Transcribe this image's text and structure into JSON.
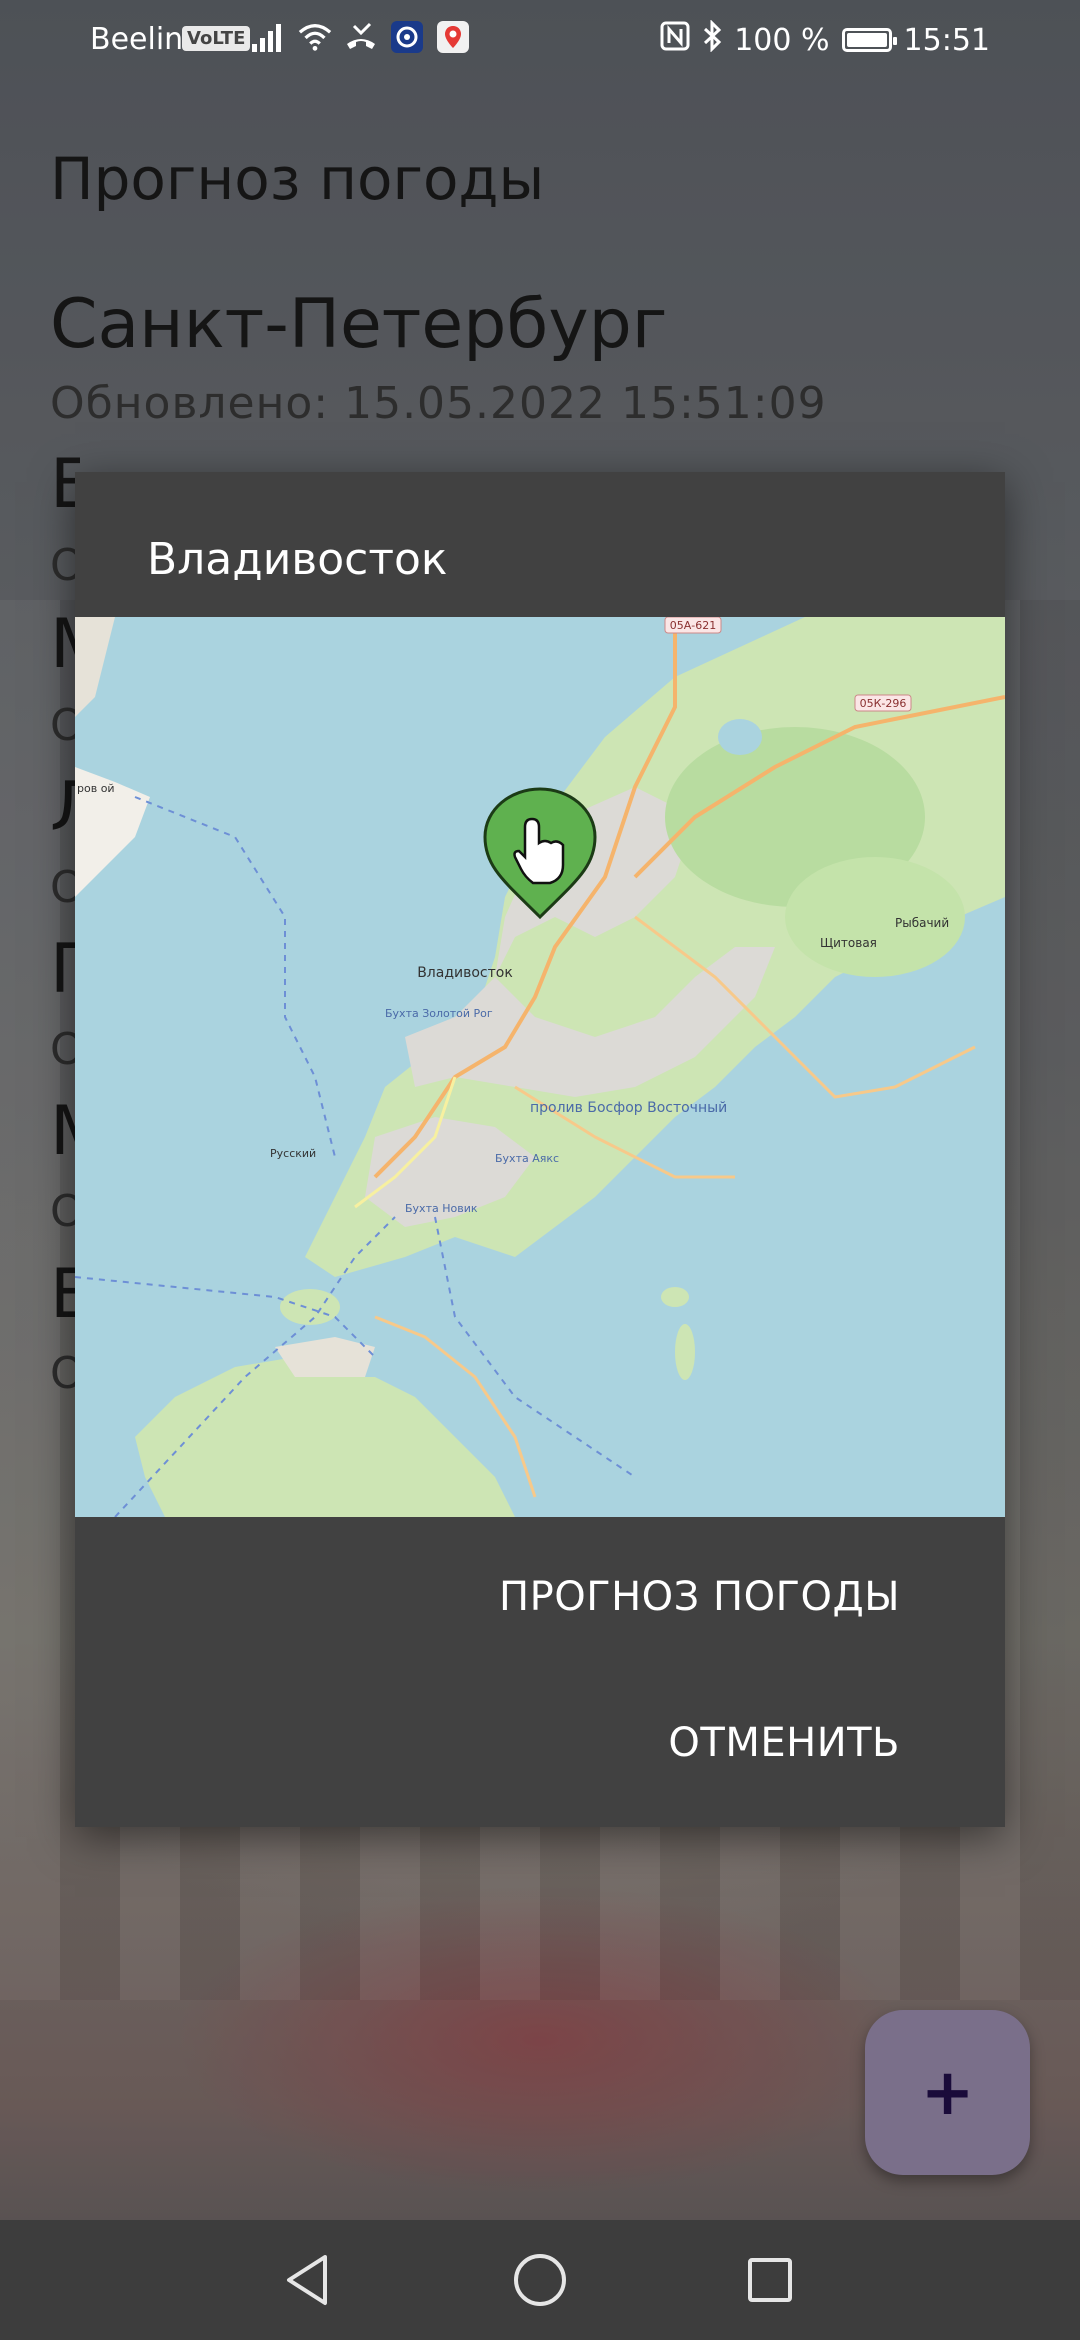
{
  "status_bar": {
    "carrier": "Beeline",
    "volte": "VoLTE",
    "battery": "100 %",
    "time": "15:51",
    "icons": [
      "signal-icon",
      "wifi-icon",
      "missed-call-icon",
      "shield-app-icon",
      "maps-app-icon",
      "nfc-icon",
      "bluetooth-icon",
      "battery-icon"
    ]
  },
  "app": {
    "title": "Прогноз погоды",
    "city": "Санкт-Петербург",
    "updated": "Обновлено: 15.05.2022 15:51:09",
    "partial_list": [
      "Е",
      "О",
      "М",
      "О",
      "Л",
      "О",
      "П",
      "О",
      "М",
      "О",
      "Е",
      "О"
    ]
  },
  "dialog": {
    "title": "Владивосток",
    "map": {
      "city_label": "Владивосток",
      "labels": {
        "strait": "пролив Босфор Восточный",
        "rybachiy": "Рыбачий",
        "shchitovaya": "Щитовая",
        "russkiy": "Русский",
        "bay_novik": "Бухта Новик",
        "bay_ayaks": "Бухта Аякс",
        "bay_zolotoy": "Бухта Золотой Рог",
        "road_1": "05А-621",
        "road_2": "05К-296",
        "island_left": "ров ой"
      },
      "marker_icon": "map-marker-hand-icon"
    },
    "buttons": {
      "forecast": "ПРОГНОЗ ПОГОДЫ",
      "cancel": "ОТМЕНИТЬ"
    }
  },
  "fab": {
    "label": "+",
    "icon": "add-icon"
  },
  "nav": {
    "icons": [
      "back-icon",
      "home-icon",
      "recents-icon"
    ]
  }
}
